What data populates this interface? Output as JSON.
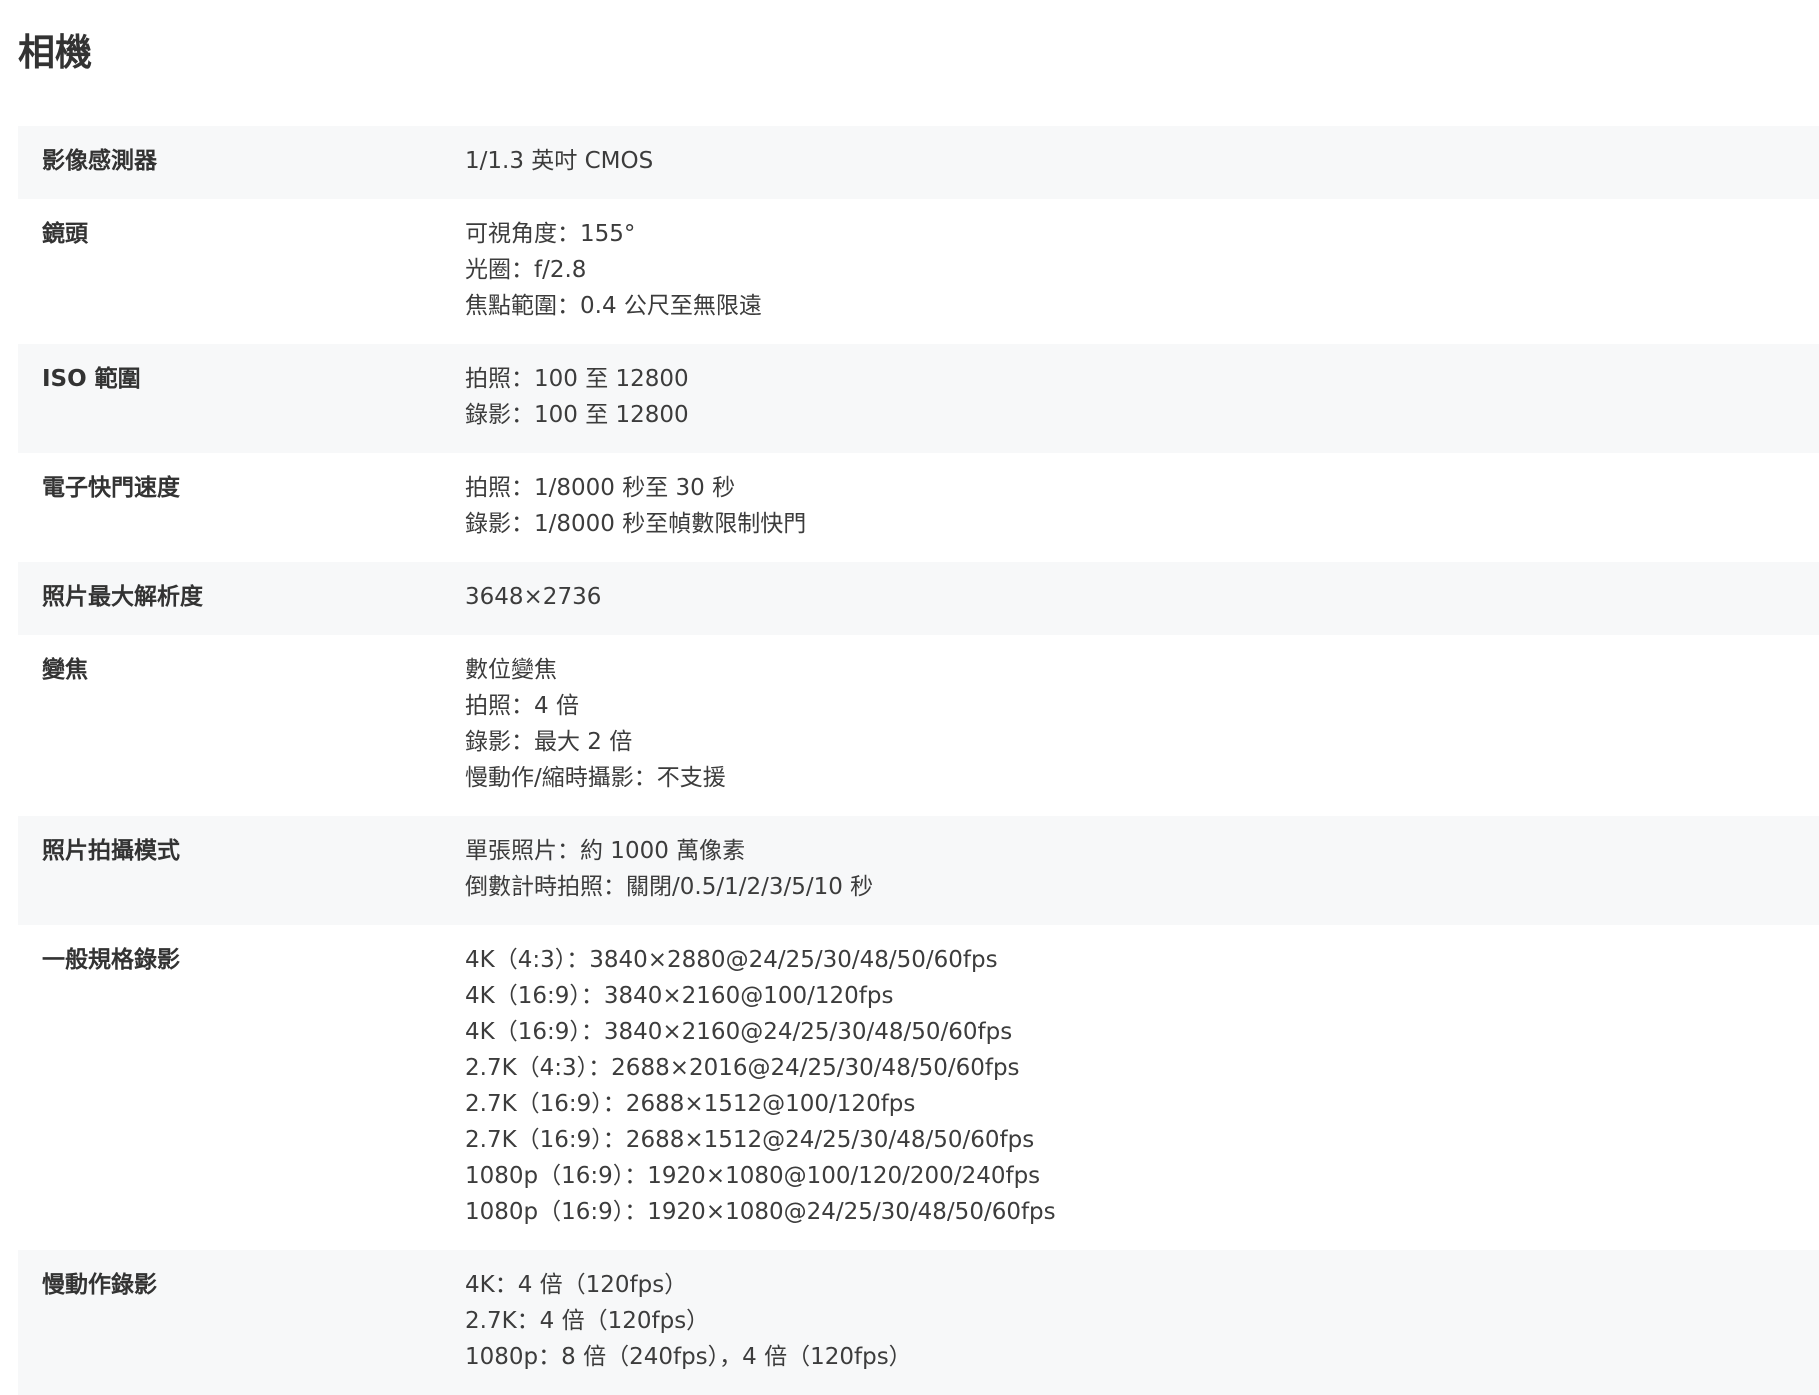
{
  "section": {
    "title": "相機"
  },
  "specs": [
    {
      "label": "影像感測器",
      "values": [
        "1/1.3 英吋 CMOS"
      ]
    },
    {
      "label": "鏡頭",
      "values": [
        "可視角度：155°",
        "光圈：f/2.8",
        "焦點範圍：0.4 公尺至無限遠"
      ]
    },
    {
      "label": "ISO 範圍",
      "values": [
        "拍照：100 至 12800",
        "錄影：100 至 12800"
      ]
    },
    {
      "label": "電子快門速度",
      "values": [
        "拍照：1/8000 秒至 30 秒",
        "錄影：1/8000 秒至幀數限制快門"
      ]
    },
    {
      "label": "照片最大解析度",
      "values": [
        "3648×2736"
      ]
    },
    {
      "label": "變焦",
      "values": [
        "數位變焦",
        "拍照：4 倍",
        "錄影：最大 2 倍",
        "慢動作/縮時攝影：不支援"
      ]
    },
    {
      "label": "照片拍攝模式",
      "values": [
        "單張照片：約 1000 萬像素",
        "倒數計時拍照：關閉/0.5/1/2/3/5/10 秒"
      ]
    },
    {
      "label": "一般規格錄影",
      "values": [
        "4K（4:3）：3840×2880@24/25/30/48/50/60fps",
        "4K（16:9）：3840×2160@100/120fps",
        "4K（16:9）：3840×2160@24/25/30/48/50/60fps",
        "2.7K（4:3）：2688×2016@24/25/30/48/50/60fps",
        "2.7K（16:9）：2688×1512@100/120fps",
        "2.7K（16:9）：2688×1512@24/25/30/48/50/60fps",
        "1080p（16:9）：1920×1080@100/120/200/240fps",
        "1080p（16:9）：1920×1080@24/25/30/48/50/60fps"
      ]
    },
    {
      "label": "慢動作錄影",
      "values": [
        "4K：4 倍（120fps）",
        "2.7K：4 倍（120fps）",
        "1080p：8 倍（240fps），4 倍（120fps）"
      ]
    }
  ]
}
